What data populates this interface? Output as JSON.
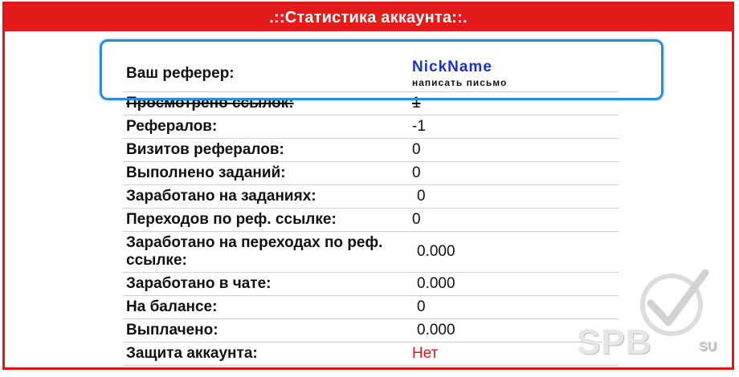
{
  "panel": {
    "title": ".::Статистика аккаунта::."
  },
  "referrer": {
    "label": "Ваш реферер:",
    "nickname": "NickName",
    "write_letter": "написать письмо"
  },
  "rows": [
    {
      "label": "Просмотрено ссылок:",
      "value": "1"
    },
    {
      "label": "Рефералов:",
      "value": "-1"
    },
    {
      "label": "Визитов рефералов:",
      "value": "0"
    },
    {
      "label": "Выполнено заданий:",
      "value": "0"
    },
    {
      "label": "Заработано на заданиях:",
      "value": "0"
    },
    {
      "label": "Переходов по реф. ссылке:",
      "value": "0"
    },
    {
      "label": "Заработано на переходах по реф. ссылке:",
      "value": "0.000"
    },
    {
      "label": "Заработано в чате:",
      "value": "0.000"
    },
    {
      "label": "На балансе:",
      "value": "0"
    },
    {
      "label": "Выплачено:",
      "value": "0.000"
    },
    {
      "label": "Защита аккаунта:",
      "value": "Нет"
    }
  ],
  "watermark": {
    "text": "SPB",
    "suffix": "SU"
  },
  "colors": {
    "header_red": "#e31b1b",
    "nick_blue": "#1a2fd6",
    "highlight_blue": "#2b8be0",
    "no_red": "#d41a1a"
  }
}
